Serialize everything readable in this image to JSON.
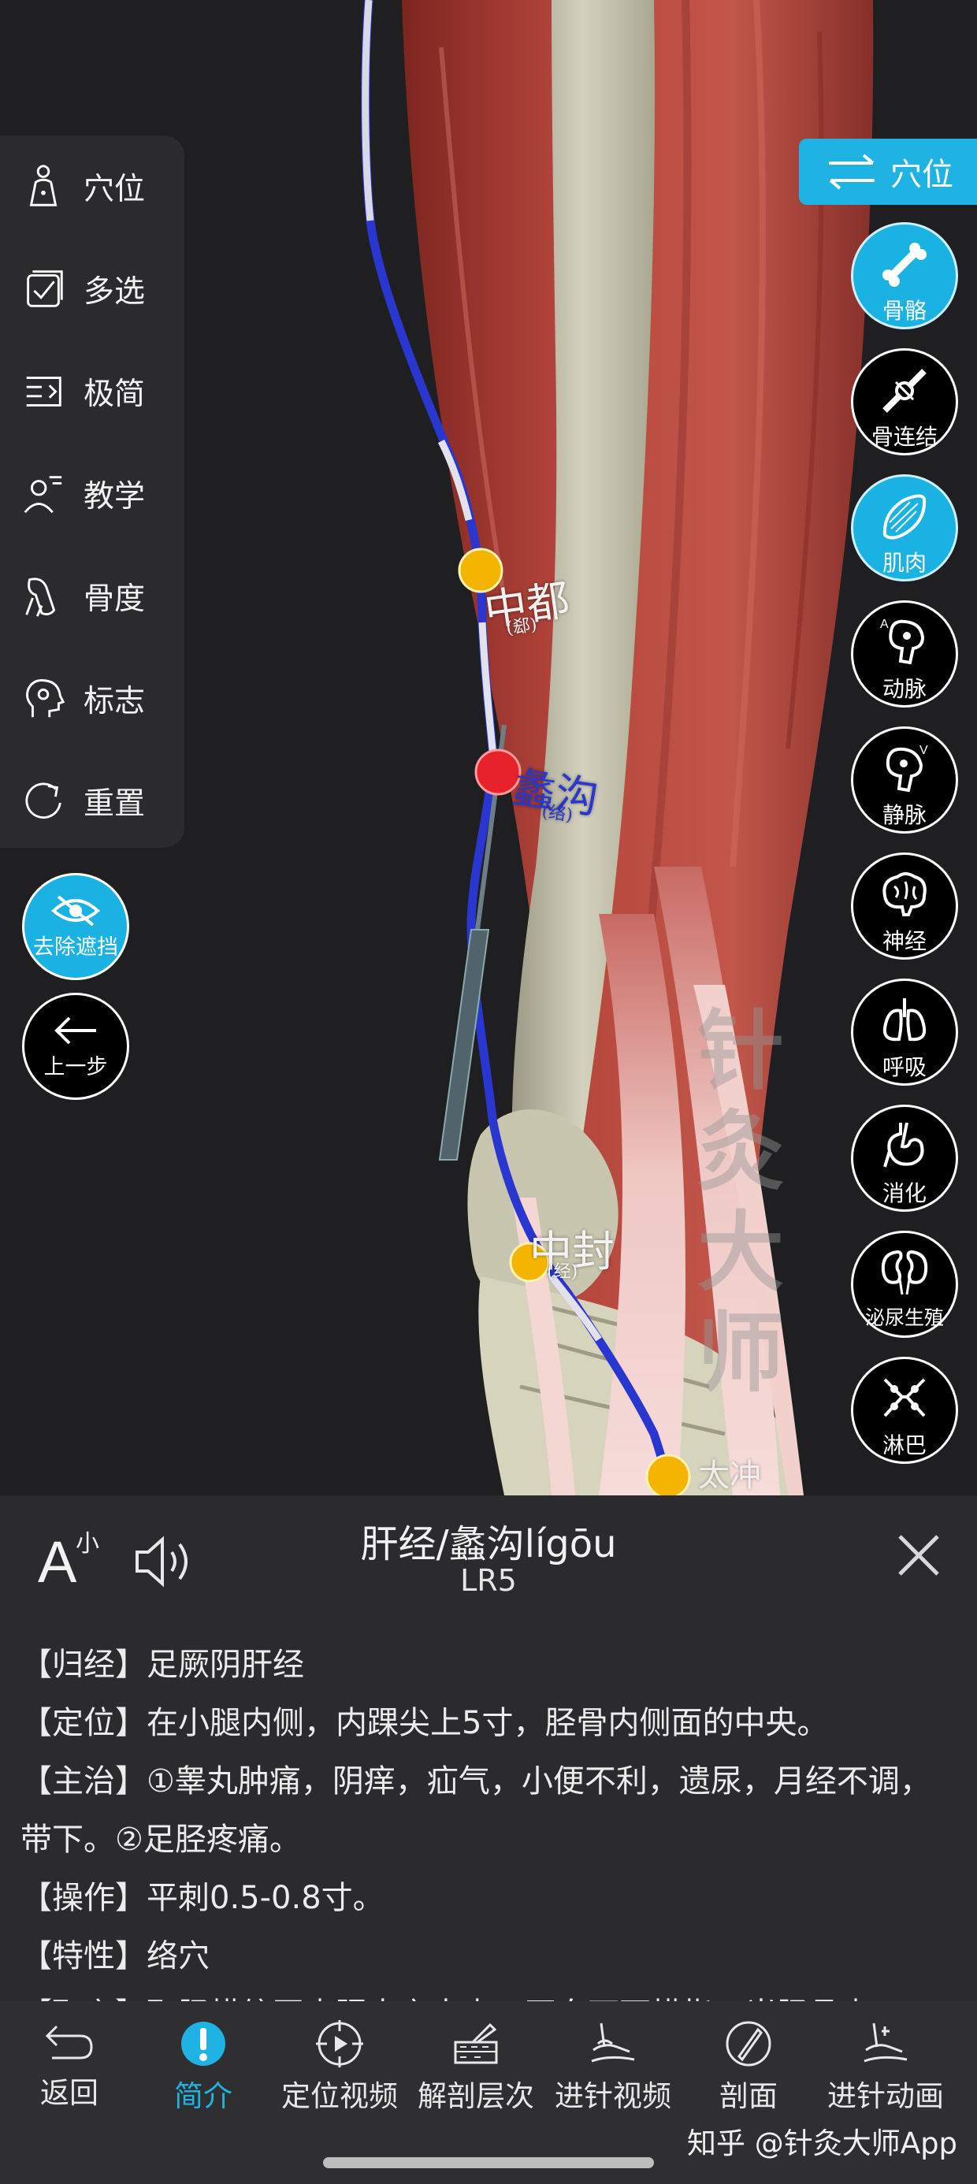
{
  "left_menu": {
    "items": [
      {
        "label": "穴位",
        "icon": "person-icon"
      },
      {
        "label": "多选",
        "icon": "checkbox-icon"
      },
      {
        "label": "极简",
        "icon": "minimal-icon"
      },
      {
        "label": "教学",
        "icon": "teacher-icon"
      },
      {
        "label": "骨度",
        "icon": "bone-measure-icon"
      },
      {
        "label": "标志",
        "icon": "head-marker-icon"
      },
      {
        "label": "重置",
        "icon": "reset-icon"
      }
    ],
    "remove_occlusion": "去除遮挡",
    "back_step": "上一步"
  },
  "right_panel": {
    "toggle_label": "穴位",
    "systems": [
      {
        "label": "骨骼",
        "icon": "bone-icon",
        "active": true
      },
      {
        "label": "骨连结",
        "icon": "joint-icon",
        "active": false
      },
      {
        "label": "肌肉",
        "icon": "muscle-icon",
        "active": true
      },
      {
        "label": "动脉",
        "icon": "artery-icon",
        "active": false
      },
      {
        "label": "静脉",
        "icon": "vein-icon",
        "active": false
      },
      {
        "label": "神经",
        "icon": "brain-icon",
        "active": false
      },
      {
        "label": "呼吸",
        "icon": "lungs-icon",
        "active": false
      },
      {
        "label": "消化",
        "icon": "stomach-icon",
        "active": false
      },
      {
        "label": "泌尿生殖",
        "icon": "kidney-icon",
        "active": false
      },
      {
        "label": "淋巴",
        "icon": "lymph-icon",
        "active": false
      }
    ]
  },
  "scene": {
    "points": [
      {
        "name": "中都",
        "sub": "(郄)"
      },
      {
        "name": "蠡沟",
        "sub": "(络)"
      },
      {
        "name": "中封",
        "sub": "(经)"
      },
      {
        "name": "太冲",
        "sub": ""
      }
    ],
    "watermark": "针灸大师"
  },
  "info": {
    "font_small": "小",
    "font_big": "A",
    "title": "肝经/蠡沟lígōu",
    "code": "LR5",
    "paragraphs": [
      "【归经】足厥阴肝经",
      "【定位】在小腿内侧，内踝尖上5寸，胫骨内侧面的中央。",
      "【主治】①睾丸肿痛，阴痒，疝气，小便不利，遗尿，月经不调，带下。②足胫疼痛。",
      "【操作】平刺0.5-0.8寸。",
      "【特性】络穴",
      "【取穴】取胫横纹至内踝尖之中点，再向下两横指，当胫骨内"
    ]
  },
  "bottom_nav": {
    "items": [
      {
        "label": "返回",
        "icon": "return-icon"
      },
      {
        "label": "简介",
        "icon": "info-icon"
      },
      {
        "label": "定位视频",
        "icon": "location-video-icon"
      },
      {
        "label": "解剖层次",
        "icon": "anatomy-layers-icon"
      },
      {
        "label": "进针视频",
        "icon": "needle-video-icon"
      },
      {
        "label": "剖面",
        "icon": "section-icon"
      },
      {
        "label": "进针动画",
        "icon": "needle-animation-icon"
      }
    ],
    "active_index": 1,
    "zhihu_watermark": "知乎 @针灸大师App"
  },
  "colors": {
    "accent": "#1eb3e3",
    "panel": "#2b2b2d",
    "meridian": "#2e3bd6",
    "active_point": "#e8222a",
    "point": "#f5b400"
  }
}
